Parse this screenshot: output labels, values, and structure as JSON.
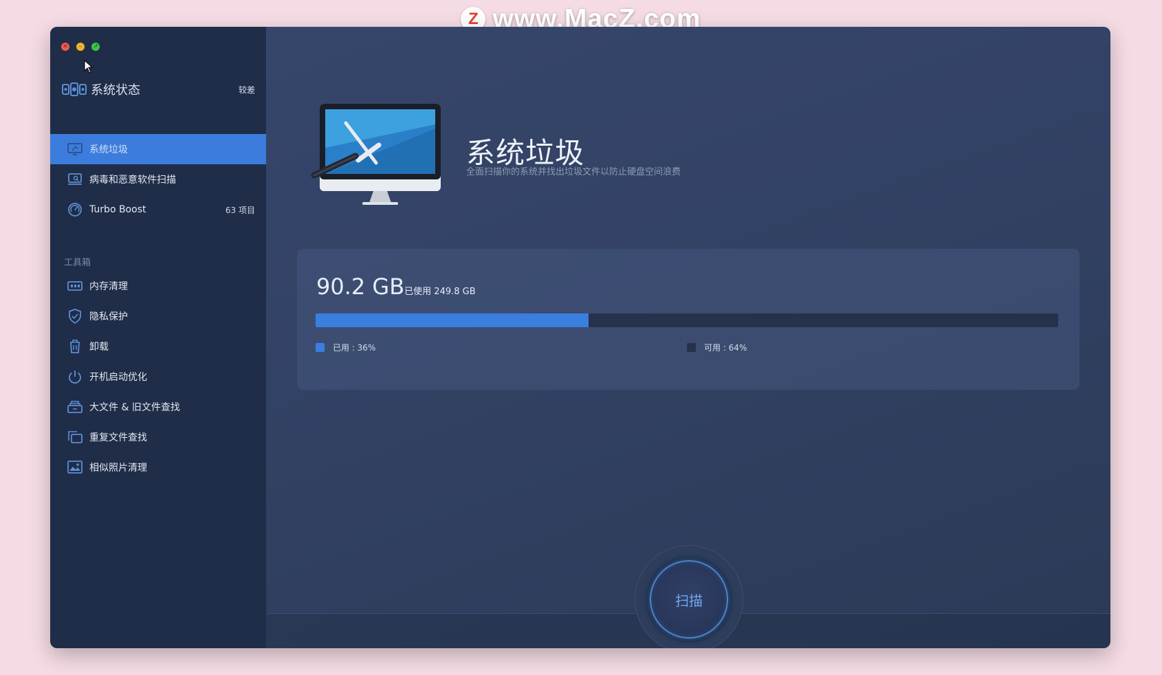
{
  "watermark": {
    "logo_letter": "Z",
    "text": "www.MacZ.com"
  },
  "window": {
    "traffic": [
      "close-icon",
      "minimize-icon",
      "zoom-icon"
    ]
  },
  "sidebar": {
    "status": {
      "title": "系统状态",
      "badge": "较差",
      "icon": "system-status-icon"
    },
    "nav": [
      {
        "label": "系统垃圾",
        "icon": "monitor-clean-icon",
        "active": true
      },
      {
        "label": "病毒和恶意软件扫描",
        "icon": "malware-scan-icon"
      },
      {
        "label": "Turbo Boost",
        "icon": "speedometer-icon",
        "count": "63 项目"
      }
    ],
    "tools_label": "工具箱",
    "tools": [
      {
        "label": "内存清理",
        "icon": "memory-icon"
      },
      {
        "label": "隐私保护",
        "icon": "shield-icon"
      },
      {
        "label": "卸载",
        "icon": "trash-icon"
      },
      {
        "label": "开机启动优化",
        "icon": "power-icon"
      },
      {
        "label": "大文件 & 旧文件查找",
        "icon": "large-files-icon"
      },
      {
        "label": "重复文件查找",
        "icon": "duplicate-files-icon"
      },
      {
        "label": "相似照片清理",
        "icon": "photo-icon"
      }
    ]
  },
  "main": {
    "title": "系统垃圾",
    "subtitle": "全面扫描你的系统并找出垃圾文件以防止硬盘空间浪费",
    "disk": {
      "size": "90.2 GB",
      "used_label": "已使用 249.8 GB",
      "used_fraction": 0.368,
      "legend_used": "已用 : 36%",
      "legend_free": "可用 : 64%"
    },
    "scan_label": "扫描"
  },
  "colors": {
    "accent": "#3c7cdc",
    "bar_used": "#3a7ee0",
    "bar_free": "#26324c",
    "sidebar_bg": "#1f2d48",
    "main_bg": "#34446a"
  }
}
